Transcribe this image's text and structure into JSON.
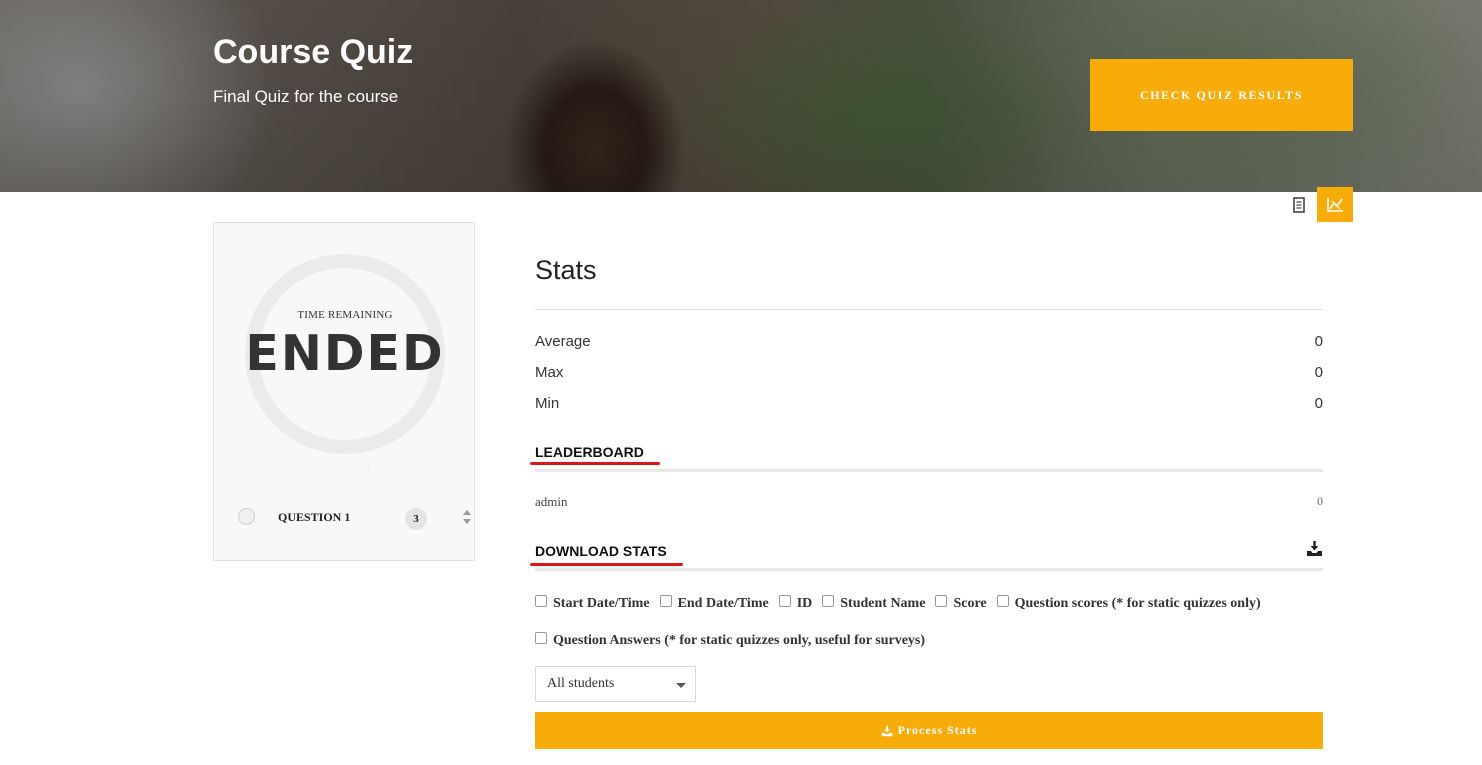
{
  "hero": {
    "title": "Course Quiz",
    "subtitle": "Final Quiz for the course",
    "button_label": "CHECK QUIZ RESULTS"
  },
  "view_toggle": {
    "items": [
      {
        "icon": "document-icon",
        "active": false
      },
      {
        "icon": "chart-icon",
        "active": true
      }
    ]
  },
  "timer": {
    "label": "TIME REMAINING",
    "value": "ENDED",
    "faint_text": "Max 0.00"
  },
  "questions": [
    {
      "label": "QUESTION 1",
      "count": "3"
    }
  ],
  "stats": {
    "title": "Stats",
    "rows": [
      {
        "label": "Average",
        "value": "0"
      },
      {
        "label": "Max",
        "value": "0"
      },
      {
        "label": "Min",
        "value": "0"
      }
    ]
  },
  "leaderboard": {
    "heading": "LEADERBOARD",
    "entries": [
      {
        "name": "admin",
        "score": "0"
      }
    ]
  },
  "download": {
    "heading": "DOWNLOAD STATS",
    "options_line1": [
      "Start Date/Time",
      "End Date/Time",
      "ID",
      "Student Name",
      "Score",
      "Question scores (* for static quizzes only)"
    ],
    "options_line2": [
      "Question Answers (* for static quizzes only, useful for surveys)"
    ],
    "filter_selected": "All students",
    "process_label": "Process Stats"
  },
  "colors": {
    "accent": "#f7ac0a",
    "annotation_red": "#e01515"
  }
}
